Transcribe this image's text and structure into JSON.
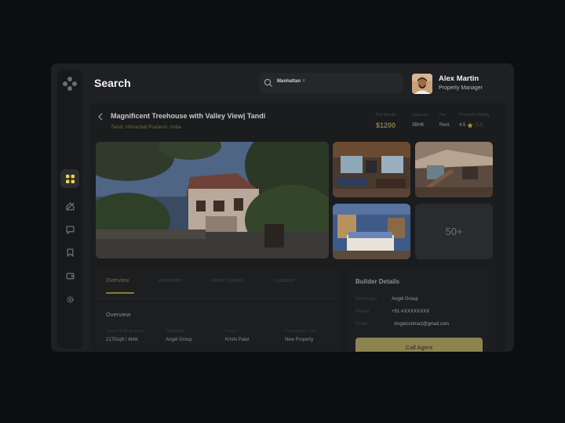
{
  "header": {
    "title": "Search"
  },
  "search": {
    "chip": "Manhattan",
    "chip_close": "×"
  },
  "user": {
    "name": "Alex Martin",
    "role": "Property Manager"
  },
  "sidebar": {
    "items": [
      {
        "icon": "grid-icon",
        "active": true
      },
      {
        "icon": "home-slash-icon",
        "active": false
      },
      {
        "icon": "chat-icon",
        "active": false
      },
      {
        "icon": "bookmark-icon",
        "active": false
      },
      {
        "icon": "wallet-icon",
        "active": false
      },
      {
        "icon": "gear-icon",
        "active": false
      }
    ]
  },
  "property": {
    "title": "Magnificent Treehouse with Valley View| Tandi",
    "address": "Tandi, Himachal Pradesh, India",
    "stats": {
      "price_label": "Per Month",
      "price_value": "$1200",
      "area_label": "Capacity",
      "area_value": "3BHK",
      "type_label": "For",
      "type_value": "Rent",
      "rating_label": "Property Rating",
      "rating_value": "4.5",
      "rating_count": "(12)"
    },
    "more_photos": "50+"
  },
  "tabs": {
    "items": [
      "Overview",
      "Amenities",
      "Home Details",
      "Location"
    ],
    "active": 0
  },
  "overview": {
    "title": "Overview",
    "fields": [
      {
        "label": "Super Built-up Area",
        "value": "2170sqft / 4bhk"
      },
      {
        "label": "Developer",
        "value": "Angel Group"
      },
      {
        "label": "Project",
        "value": "Krishi Patel"
      },
      {
        "label": "Transaction type",
        "value": "New Property"
      }
    ]
  },
  "builder": {
    "title": "Builder Details",
    "rows": [
      {
        "label": "Developer",
        "value": "Angel Group"
      },
      {
        "label": "Phone",
        "value": "+91-XXXXXXXXX"
      },
      {
        "label": "Email",
        "value": "Angelcontract@gmail.com"
      }
    ],
    "call_label": "Call Agent"
  },
  "colors": {
    "accent": "#8c8450",
    "background": "#1f2023",
    "active_icon": "#e8d84a"
  }
}
